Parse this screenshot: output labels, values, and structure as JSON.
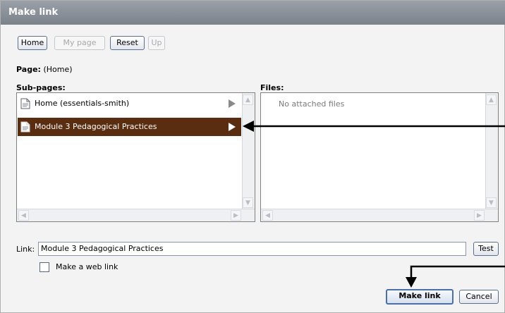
{
  "dialog": {
    "title": "Make link"
  },
  "toolbar": {
    "home": "Home",
    "my_page": "My page",
    "reset": "Reset",
    "up": "Up"
  },
  "page": {
    "label": "Page:",
    "value": "(Home)"
  },
  "subpages": {
    "label": "Sub-pages:",
    "items": [
      {
        "label": "Home (essentials-smith)",
        "selected": false
      },
      {
        "label": "Module 3 Pedagogical Practices",
        "selected": true
      }
    ]
  },
  "files": {
    "label": "Files:",
    "empty_text": "No attached files"
  },
  "link": {
    "label": "Link:",
    "value": "Module 3 Pedagogical Practices",
    "test": "Test"
  },
  "web_link": {
    "label": "Make a web link",
    "checked": false
  },
  "actions": {
    "make_link": "Make link",
    "cancel": "Cancel"
  },
  "colors": {
    "titlebar": "#8a9099",
    "selection": "#5a2c10",
    "accent_border": "#4c6fa8"
  }
}
